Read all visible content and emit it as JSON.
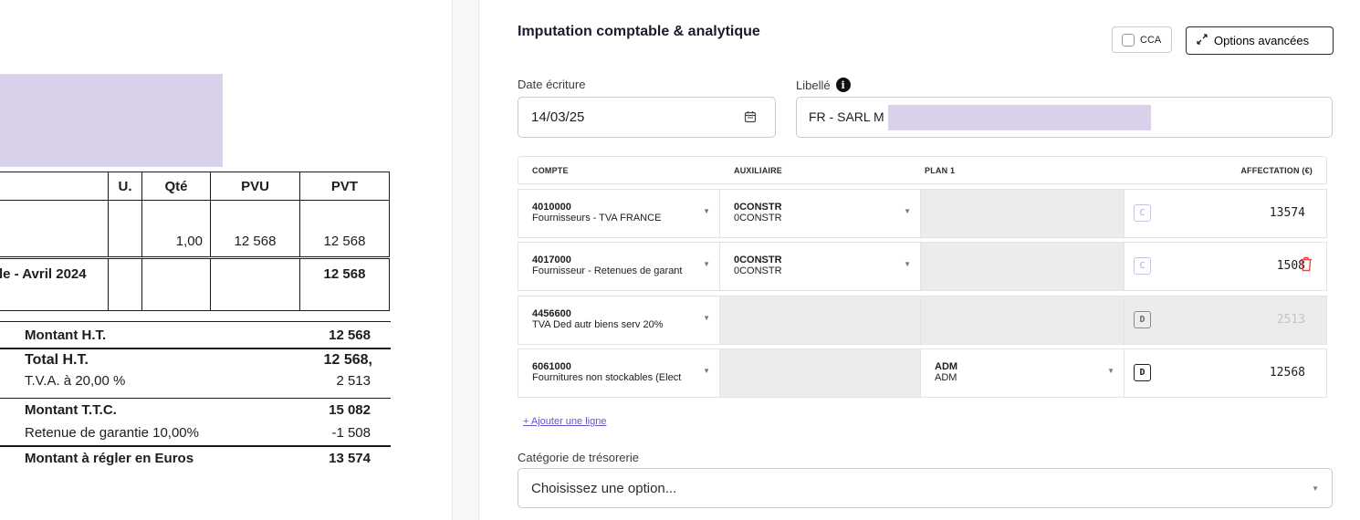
{
  "invoice": {
    "headers": [
      "U.",
      "Qté",
      "PVU",
      "PVT"
    ],
    "line1": {
      "qte": "1,00",
      "pvu": "12 568",
      "pvt": "12 568"
    },
    "line2": {
      "label": "le - Avril 2024",
      "pvt": "12 568"
    },
    "totals": [
      {
        "label": "Montant H.T.",
        "value": "12 568",
        "bold": true
      },
      {
        "label": "Total H.T.",
        "value": "12 568,",
        "bold": true
      },
      {
        "label": "T.V.A. à 20,00 %",
        "value": "2 513",
        "bold": false
      },
      {
        "label": "Montant T.T.C.",
        "value": "15 082",
        "bold": true
      },
      {
        "label": "Retenue de garantie 10,00%",
        "value": "-1 508",
        "bold": false
      },
      {
        "label": "Montant à régler en Euros",
        "value": "13 574",
        "bold": true
      }
    ]
  },
  "form": {
    "title": "Imputation comptable & analytique",
    "cca_label": "CCA",
    "advanced_label": "Options avancées",
    "date_label": "Date écriture",
    "date_value": "14/03/25",
    "libelle_label": "Libellé",
    "libelle_value": "FR - SARL M",
    "columns": {
      "compte": "COMPTE",
      "auxiliaire": "AUXILIAIRE",
      "plan": "PLAN 1",
      "affectation": "AFFECTATION (€)"
    },
    "rows": [
      {
        "code": "4010000",
        "name": "Fournisseurs - TVA FRANCE",
        "aux_code": "0CONSTR",
        "aux_name": "0CONSTR",
        "plan_code": "",
        "plan_name": "",
        "cd": "C",
        "amount": "13574"
      },
      {
        "code": "4017000",
        "name": "Fournisseur - Retenues de garant",
        "aux_code": "0CONSTR",
        "aux_name": "0CONSTR",
        "plan_code": "",
        "plan_name": "",
        "cd": "C",
        "amount": "1508"
      },
      {
        "code": "4456600",
        "name": "TVA Ded autr biens serv 20%",
        "aux_code": "",
        "aux_name": "",
        "plan_code": "",
        "plan_name": "",
        "cd": "D",
        "amount": "2513"
      },
      {
        "code": "6061000",
        "name": "Fournitures non stockables (Elect",
        "aux_code": "",
        "aux_name": "",
        "plan_code": "ADM",
        "plan_name": "ADM",
        "cd": "D",
        "amount": "12568"
      }
    ],
    "add_line_label": "+ Ajouter une ligne",
    "treso_label": "Catégorie de trésorerie",
    "treso_placeholder": "Choisissez une option..."
  },
  "colors": {
    "accent": "#6257c7",
    "redaction": "#d9d0ea",
    "danger": "#e5484d"
  }
}
